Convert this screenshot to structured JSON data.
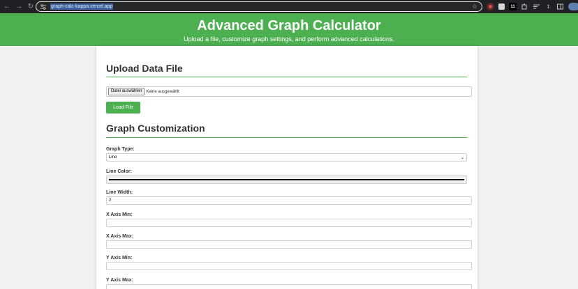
{
  "browser": {
    "url": "graph-calc-kappa.vercel.app"
  },
  "header": {
    "title": "Advanced Graph Calculator",
    "subtitle": "Upload a file, customize graph settings, and perform advanced calculations."
  },
  "upload": {
    "title": "Upload Data File",
    "choose_label": "Datei auswählen",
    "no_file_label": "Keine ausgewählt",
    "load_label": "Load File"
  },
  "custom": {
    "title": "Graph Customization",
    "graph_type_label": "Graph Type:",
    "graph_type_value": "Line",
    "line_color_label": "Line Color:",
    "line_color_value": "#000000",
    "line_width_label": "Line Width:",
    "line_width_value": "2",
    "x_min_label": "X Axis Min:",
    "x_max_label": "X Axis Max:",
    "y_min_label": "Y Axis Min:",
    "y_max_label": "Y Axis Max:"
  },
  "colors": {
    "accent": "#4caf50",
    "chrome_bg": "#202124"
  }
}
